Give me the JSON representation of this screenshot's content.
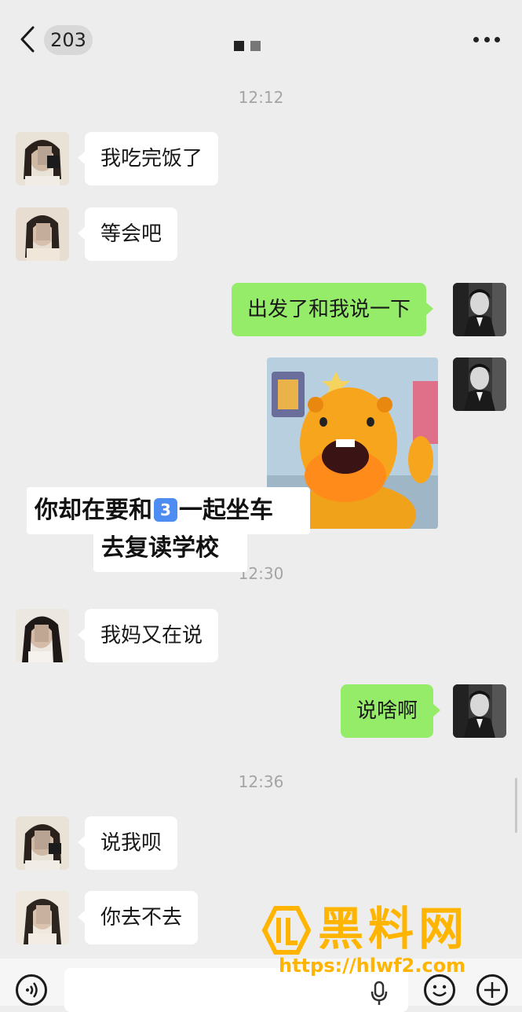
{
  "header": {
    "unread_count": "203"
  },
  "messages": [
    {
      "time": "12:12"
    },
    {
      "from": "them",
      "text": "我吃完饭了"
    },
    {
      "from": "them",
      "text": "等会吧"
    },
    {
      "from": "me",
      "text": "出发了和我说一下"
    },
    {
      "from": "me",
      "type": "sticker"
    },
    {
      "time": "12:30"
    },
    {
      "from": "them",
      "text": "我妈又在说"
    },
    {
      "from": "me",
      "text": "说啥啊"
    },
    {
      "time": "12:36"
    },
    {
      "from": "them",
      "text": "说我呗"
    },
    {
      "from": "them",
      "text": "你去不去"
    }
  ],
  "caption": {
    "line1_before": "你却在要和",
    "line1_number": "3",
    "line1_after": "一起坐车",
    "line2": "去复读学校"
  },
  "watermark": {
    "name": "黑料网",
    "url": "https://hlwf2.com"
  },
  "colors": {
    "incoming_bubble": "#ffffff",
    "outgoing_bubble": "#95ec69",
    "background": "#ededed",
    "watermark": "#ffb400"
  }
}
